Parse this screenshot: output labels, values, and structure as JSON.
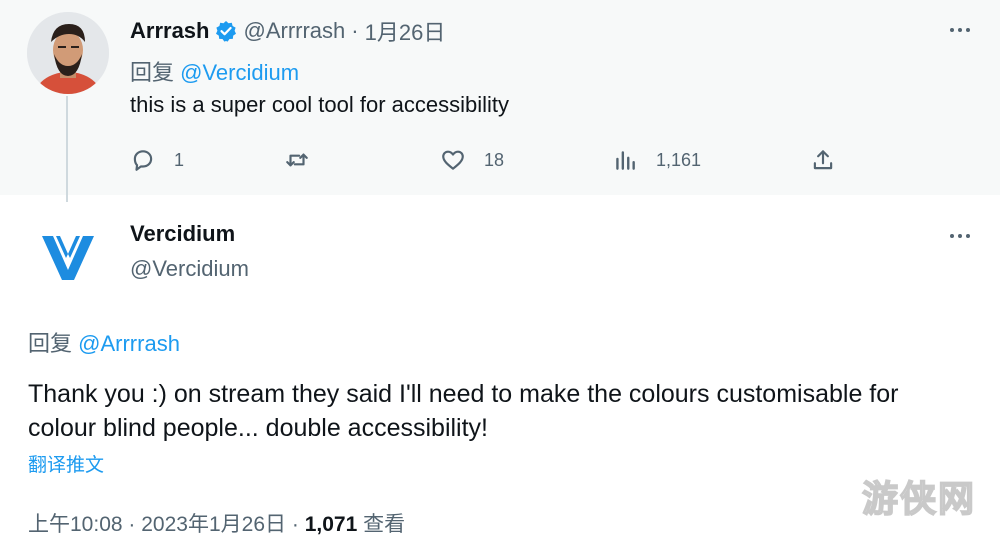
{
  "reply_tweet": {
    "display_name": "Arrrash",
    "handle": "@Arrrrash",
    "separator": "·",
    "date": "1月26日",
    "reply_to_prefix": "回复",
    "reply_to_handle": "@Vercidium",
    "text": "this is a super cool tool for accessibility",
    "actions": {
      "reply_count": "1",
      "retweet_count": "",
      "like_count": "18",
      "views_count": "1,161"
    },
    "icons": {
      "reply": "speech-bubble-icon",
      "retweet": "retweet-arrows-icon",
      "like": "heart-icon",
      "views": "bar-chart-icon",
      "share": "share-upload-icon",
      "verified": "verified-badge-icon",
      "more": "more-dots-icon"
    },
    "colors": {
      "verified": "#1d9bf0",
      "background": "#f7f9f9"
    }
  },
  "main_tweet": {
    "display_name": "Vercidium",
    "handle": "@Vercidium",
    "reply_to_prefix": "回复",
    "reply_to_handle": "@Arrrrash",
    "text": "Thank you :) on stream they said I'll need to make the colours customisable for colour blind people... double accessibility!",
    "translate_label": "翻译推文",
    "time": "上午10:08",
    "separator": "·",
    "date": "2023年1月26日",
    "views_count": "1,071",
    "views_label": "查看",
    "logo_icon": "vercidium-logo-icon",
    "colors": {
      "logo": "#1d8ce0",
      "link": "#1d9bf0"
    }
  },
  "watermark": "游侠网"
}
